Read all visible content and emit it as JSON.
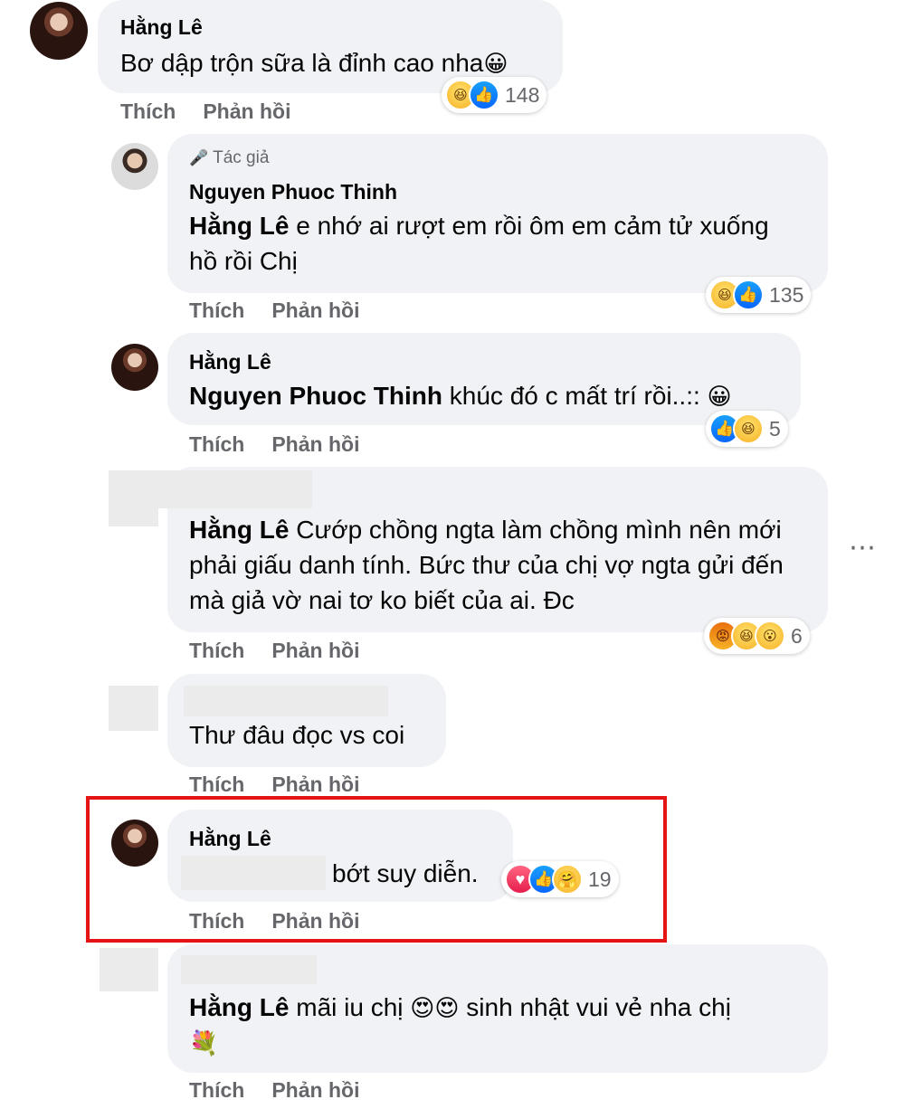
{
  "actions": {
    "like": "Thích",
    "reply": "Phản hồi"
  },
  "author_tag": "Tác giả",
  "more_icon": "⋯",
  "comments": [
    {
      "name": "Hằng Lê",
      "text": "Bơ dập trộn sữa là đỉnh cao nha",
      "emoji": "😀",
      "reactions": [
        "haha",
        "like"
      ],
      "count": "148"
    },
    {
      "name": "Nguyen Phuoc Thinh",
      "mention": "Hằng Lê",
      "text": " e nhớ ai rượt em rồi ôm em cảm tử xuống hồ rồi Chị",
      "reactions": [
        "haha",
        "like"
      ],
      "count": "135"
    },
    {
      "name": "Hằng Lê",
      "mention": "Nguyen Phuoc Thinh",
      "text": " khúc đó c mất trí rồi..:: ",
      "emoji": "😀",
      "reactions": [
        "like",
        "haha"
      ],
      "count": "5"
    },
    {
      "mention": "Hằng Lê",
      "text": " Cướp chồng ngta làm chồng mình nên mới phải giấu danh tính. Bức thư của chị vợ ngta gửi đến mà giả vờ nai tơ ko biết của ai. Đc",
      "reactions": [
        "angry",
        "haha",
        "wow"
      ],
      "count": "6"
    },
    {
      "text": "Thư đâu đọc vs coi"
    },
    {
      "name": "Hằng Lê",
      "text": "bớt suy diễn.",
      "reactions": [
        "love",
        "like",
        "care"
      ],
      "count": "19"
    },
    {
      "mention": "Hằng Lê",
      "text": " mãi iu chị ",
      "emoji2": "😍😍",
      "text2": " sinh nhật vui vẻ nha chị",
      "emoji3": "💐"
    }
  ],
  "colors": {
    "highlight": "#e41414",
    "bubble": "#f0f2f5",
    "meta": "#65676b"
  },
  "reaction_glyphs": {
    "like": "👍",
    "haha": "😆",
    "wow": "😮",
    "angry": "😡",
    "love": "♥",
    "care": "🤗",
    "mic": "🎤"
  }
}
